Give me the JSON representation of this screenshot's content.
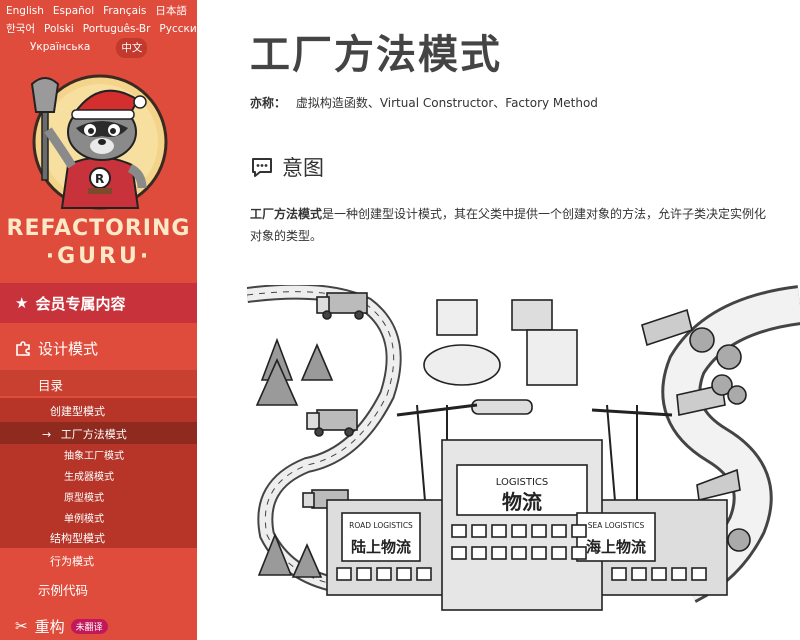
{
  "languages": {
    "row1": [
      "English",
      "Español",
      "Français",
      "日本語"
    ],
    "row2": [
      "한국어",
      "Polski",
      "Português-Br",
      "Русский"
    ],
    "row3": [
      "Українська",
      "中文"
    ]
  },
  "brand": {
    "line1": "REFACTORING",
    "line2": "·GURU·"
  },
  "nav": {
    "members": "会员专属内容",
    "design_patterns": "设计模式",
    "catalog": "目录",
    "creational": "创建型模式",
    "factory_method": "工厂方法模式",
    "abstract_factory": "抽象工厂模式",
    "builder": "生成器模式",
    "prototype": "原型模式",
    "singleton": "单例模式",
    "structural": "结构型模式",
    "behavioral": "行为模式",
    "examples": "示例代码",
    "refactoring": "重构",
    "untranslated_badge": "未翻译"
  },
  "page": {
    "title": "工厂方法模式",
    "aka_label": "亦称：",
    "aka_value": "虚拟构造函数、Virtual Constructor、Factory Method",
    "intent_heading": "意图",
    "desc_bold": "工厂方法模式",
    "desc_rest": "是一种创建型设计模式，其在父类中提供一个创建对象的方法，允许子类决定实例化对象的类型。"
  },
  "illustration": {
    "main_en": "LOGISTICS",
    "main_zh": "物流",
    "road_en": "ROAD LOGISTICS",
    "road_zh": "陆上物流",
    "sea_en": "SEA LOGISTICS",
    "sea_zh": "海上物流"
  },
  "colors": {
    "sidebar": "#e04c3c",
    "members_band": "#c8323a",
    "active_row": "#8f2a1f",
    "brand_text": "#fde9c7",
    "badge": "#c2185b"
  }
}
